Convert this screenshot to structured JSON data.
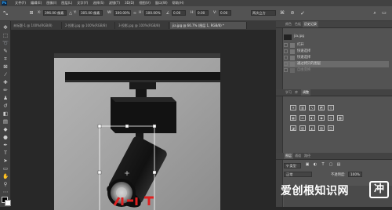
{
  "app": {
    "logo_text": "Ps"
  },
  "menubar": {
    "items": [
      "文件(F)",
      "编辑(E)",
      "图像(I)",
      "图层(L)",
      "文字(Y)",
      "选择(S)",
      "滤镜(T)",
      "3D(D)",
      "视图(V)",
      "窗口(W)",
      "帮助(H)"
    ]
  },
  "options": {
    "x_label": "X:",
    "x_value": "396.00 像素",
    "y_label": "Y:",
    "y_value": "305.00 像素",
    "w_label": "W:",
    "w_value": "100.00%",
    "h_label": "H:",
    "h_value": "100.00%",
    "angle_value": "0.00",
    "hskew_label": "H:",
    "hskew_value": "0.00",
    "vskew_label": "V:",
    "vskew_value": "0.00",
    "interp_value": "两次立方"
  },
  "tabs": [
    {
      "label": "未标题-1 @ 100%(RGB/8)",
      "active": false
    },
    {
      "label": "2-投影.jpg @ 100%(RGB/8)",
      "active": false
    },
    {
      "label": "3-投影.jpg @ 100%(RGB/8)",
      "active": false
    },
    {
      "label": "jia.jpg @ 66.7% (图层 1, RGB/8) *",
      "active": true
    }
  ],
  "panels": {
    "top_tabs": [
      "颜色",
      "色板",
      "历史记录"
    ],
    "history": [
      {
        "label": "jia.jpg",
        "selected": false
      },
      {
        "label": "打开",
        "selected": false
      },
      {
        "label": "快速选择",
        "selected": false
      },
      {
        "label": "快速选择",
        "selected": false
      },
      {
        "label": "通过拷贝的图层",
        "selected": true
      },
      {
        "label": "自由变换",
        "selected": false
      }
    ],
    "mid_tabs": [
      "学习",
      "库",
      "调整"
    ],
    "layers_tabs": [
      "图层",
      "通道",
      "路径"
    ],
    "layers_kind": "类型",
    "layers_blend": "正常",
    "layers_opacity_label": "不透明度:",
    "layers_opacity_value": "100%"
  },
  "watermark": {
    "text": "爱创根知识网",
    "box_char": "冲"
  },
  "colors": {
    "menubar": "#424242",
    "options": "#535353",
    "panel": "#535353",
    "workspace": "#282828",
    "accent": "#31a8ff"
  }
}
